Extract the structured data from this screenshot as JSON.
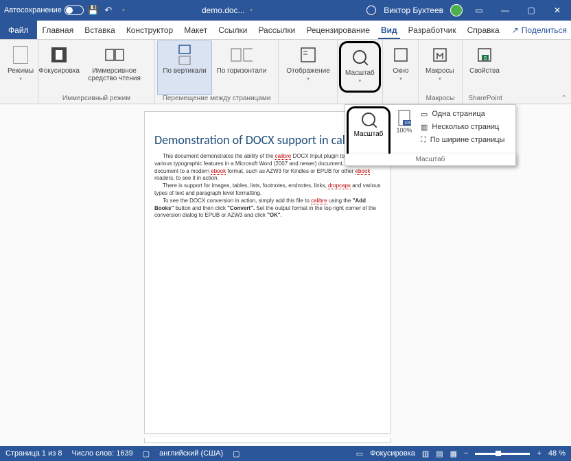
{
  "titlebar": {
    "autosave": "Автосохранение",
    "doc": "demo.doc...",
    "user": "Виктор Бухтеев"
  },
  "tabs": {
    "file": "Файл",
    "items": [
      "Главная",
      "Вставка",
      "Конструктор",
      "Макет",
      "Ссылки",
      "Рассылки",
      "Рецензирование",
      "Вид",
      "Разработчик",
      "Справка"
    ],
    "active": "Вид",
    "share": "Поделиться"
  },
  "ribbon": {
    "modes": {
      "btn": "Режимы"
    },
    "immersive": {
      "focus": "Фокусировка",
      "reader": "Иммерсивное средство чтения",
      "label": "Иммерсивный режим"
    },
    "pagenav": {
      "vert": "По вертикали",
      "horiz": "По горизонтали",
      "label": "Перемещение между страницами"
    },
    "display": {
      "btn": "Отображение"
    },
    "zoom": {
      "btn": "Масштаб"
    },
    "window": {
      "btn": "Окно"
    },
    "macros": {
      "btn": "Макросы",
      "label": "Макросы"
    },
    "sp": {
      "btn": "Свойства",
      "label": "SharePoint"
    }
  },
  "popup": {
    "zoom_btn": "Масштаб",
    "pct": "100%",
    "one": "Одна страница",
    "many": "Несколько страниц",
    "width": "По ширине страницы",
    "label": "Масштаб"
  },
  "doc": {
    "title": "Demonstration of DOCX support in calibre",
    "p1a": "This document demonstrates the ability of the ",
    "p1u1": "calibre",
    "p1b": " DOCX Input plugin to convert the various typographic features in a Microsoft Word (2007 and newer) document. Convert this document to a modern ",
    "p1u2": "ebook",
    "p1c": " format, such as AZW3 for Kindles or EPUB for other ",
    "p1u3": "ebook",
    "p1d": " readers, to see it in action.",
    "p2a": "There is support for images, tables, lists, footnotes, endnotes, links, ",
    "p2u": "dropcaps",
    "p2b": " and various types of text and paragraph level formatting.",
    "p3a": "To see the DOCX conversion in action, simply add this file to ",
    "p3u": "calibre",
    "p3b": " using the ",
    "p3c": "\"Add Books\"",
    "p3d": " button and then click ",
    "p3e": "\"Convert\".",
    "p3f": " Set the output format in the top right corner of the conversion dialog to EPUB or AZW3 and click ",
    "p3g": "\"OK\"",
    "p3h": "."
  },
  "status": {
    "page": "Страница 1 из 8",
    "words": "Число слов: 1639",
    "lang": "английский (США)",
    "focus": "Фокусировка",
    "zoom": "48 %"
  }
}
